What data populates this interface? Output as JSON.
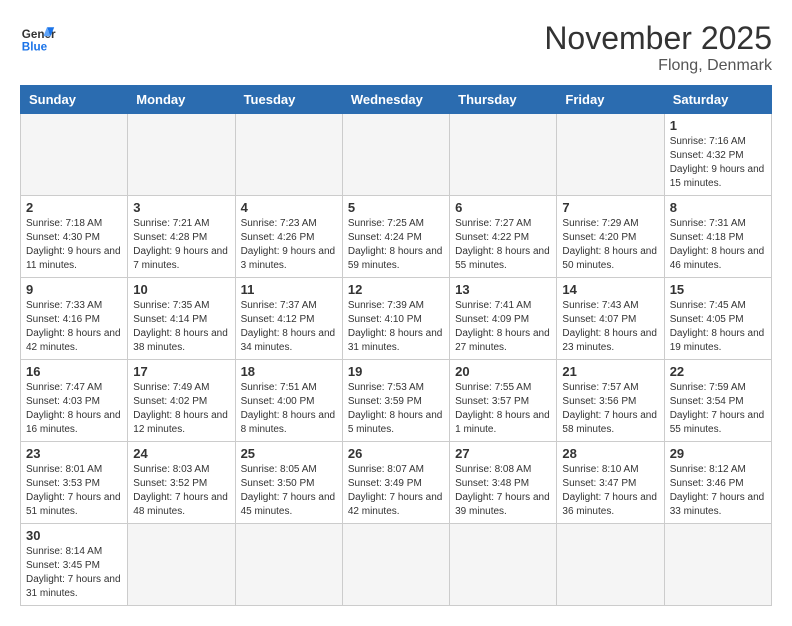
{
  "logo": {
    "line1": "General",
    "line2": "Blue"
  },
  "title": "November 2025",
  "location": "Flong, Denmark",
  "weekdays": [
    "Sunday",
    "Monday",
    "Tuesday",
    "Wednesday",
    "Thursday",
    "Friday",
    "Saturday"
  ],
  "weeks": [
    [
      {
        "day": "",
        "info": ""
      },
      {
        "day": "",
        "info": ""
      },
      {
        "day": "",
        "info": ""
      },
      {
        "day": "",
        "info": ""
      },
      {
        "day": "",
        "info": ""
      },
      {
        "day": "",
        "info": ""
      },
      {
        "day": "1",
        "info": "Sunrise: 7:16 AM\nSunset: 4:32 PM\nDaylight: 9 hours and 15 minutes."
      }
    ],
    [
      {
        "day": "2",
        "info": "Sunrise: 7:18 AM\nSunset: 4:30 PM\nDaylight: 9 hours and 11 minutes."
      },
      {
        "day": "3",
        "info": "Sunrise: 7:21 AM\nSunset: 4:28 PM\nDaylight: 9 hours and 7 minutes."
      },
      {
        "day": "4",
        "info": "Sunrise: 7:23 AM\nSunset: 4:26 PM\nDaylight: 9 hours and 3 minutes."
      },
      {
        "day": "5",
        "info": "Sunrise: 7:25 AM\nSunset: 4:24 PM\nDaylight: 8 hours and 59 minutes."
      },
      {
        "day": "6",
        "info": "Sunrise: 7:27 AM\nSunset: 4:22 PM\nDaylight: 8 hours and 55 minutes."
      },
      {
        "day": "7",
        "info": "Sunrise: 7:29 AM\nSunset: 4:20 PM\nDaylight: 8 hours and 50 minutes."
      },
      {
        "day": "8",
        "info": "Sunrise: 7:31 AM\nSunset: 4:18 PM\nDaylight: 8 hours and 46 minutes."
      }
    ],
    [
      {
        "day": "9",
        "info": "Sunrise: 7:33 AM\nSunset: 4:16 PM\nDaylight: 8 hours and 42 minutes."
      },
      {
        "day": "10",
        "info": "Sunrise: 7:35 AM\nSunset: 4:14 PM\nDaylight: 8 hours and 38 minutes."
      },
      {
        "day": "11",
        "info": "Sunrise: 7:37 AM\nSunset: 4:12 PM\nDaylight: 8 hours and 34 minutes."
      },
      {
        "day": "12",
        "info": "Sunrise: 7:39 AM\nSunset: 4:10 PM\nDaylight: 8 hours and 31 minutes."
      },
      {
        "day": "13",
        "info": "Sunrise: 7:41 AM\nSunset: 4:09 PM\nDaylight: 8 hours and 27 minutes."
      },
      {
        "day": "14",
        "info": "Sunrise: 7:43 AM\nSunset: 4:07 PM\nDaylight: 8 hours and 23 minutes."
      },
      {
        "day": "15",
        "info": "Sunrise: 7:45 AM\nSunset: 4:05 PM\nDaylight: 8 hours and 19 minutes."
      }
    ],
    [
      {
        "day": "16",
        "info": "Sunrise: 7:47 AM\nSunset: 4:03 PM\nDaylight: 8 hours and 16 minutes."
      },
      {
        "day": "17",
        "info": "Sunrise: 7:49 AM\nSunset: 4:02 PM\nDaylight: 8 hours and 12 minutes."
      },
      {
        "day": "18",
        "info": "Sunrise: 7:51 AM\nSunset: 4:00 PM\nDaylight: 8 hours and 8 minutes."
      },
      {
        "day": "19",
        "info": "Sunrise: 7:53 AM\nSunset: 3:59 PM\nDaylight: 8 hours and 5 minutes."
      },
      {
        "day": "20",
        "info": "Sunrise: 7:55 AM\nSunset: 3:57 PM\nDaylight: 8 hours and 1 minute."
      },
      {
        "day": "21",
        "info": "Sunrise: 7:57 AM\nSunset: 3:56 PM\nDaylight: 7 hours and 58 minutes."
      },
      {
        "day": "22",
        "info": "Sunrise: 7:59 AM\nSunset: 3:54 PM\nDaylight: 7 hours and 55 minutes."
      }
    ],
    [
      {
        "day": "23",
        "info": "Sunrise: 8:01 AM\nSunset: 3:53 PM\nDaylight: 7 hours and 51 minutes."
      },
      {
        "day": "24",
        "info": "Sunrise: 8:03 AM\nSunset: 3:52 PM\nDaylight: 7 hours and 48 minutes."
      },
      {
        "day": "25",
        "info": "Sunrise: 8:05 AM\nSunset: 3:50 PM\nDaylight: 7 hours and 45 minutes."
      },
      {
        "day": "26",
        "info": "Sunrise: 8:07 AM\nSunset: 3:49 PM\nDaylight: 7 hours and 42 minutes."
      },
      {
        "day": "27",
        "info": "Sunrise: 8:08 AM\nSunset: 3:48 PM\nDaylight: 7 hours and 39 minutes."
      },
      {
        "day": "28",
        "info": "Sunrise: 8:10 AM\nSunset: 3:47 PM\nDaylight: 7 hours and 36 minutes."
      },
      {
        "day": "29",
        "info": "Sunrise: 8:12 AM\nSunset: 3:46 PM\nDaylight: 7 hours and 33 minutes."
      }
    ],
    [
      {
        "day": "30",
        "info": "Sunrise: 8:14 AM\nSunset: 3:45 PM\nDaylight: 7 hours and 31 minutes."
      },
      {
        "day": "",
        "info": ""
      },
      {
        "day": "",
        "info": ""
      },
      {
        "day": "",
        "info": ""
      },
      {
        "day": "",
        "info": ""
      },
      {
        "day": "",
        "info": ""
      },
      {
        "day": "",
        "info": ""
      }
    ]
  ]
}
